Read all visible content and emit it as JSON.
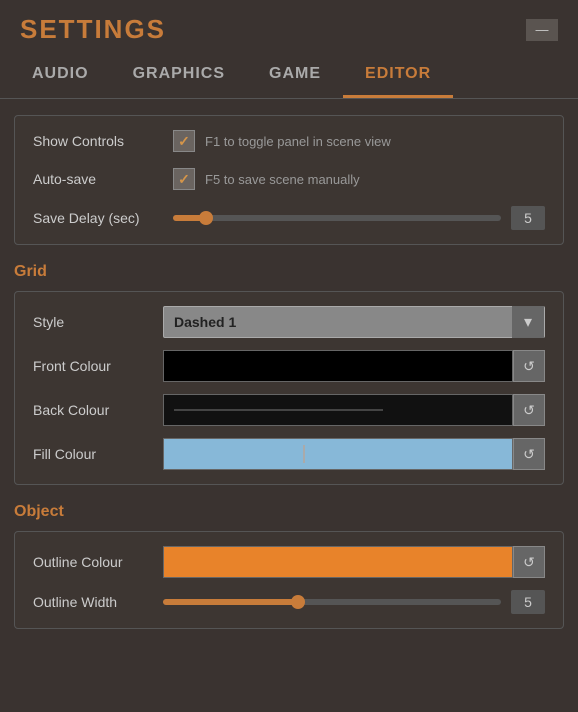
{
  "header": {
    "title": "SETTINGS",
    "close_label": "—"
  },
  "nav": {
    "tabs": [
      {
        "id": "audio",
        "label": "AUDIO",
        "active": false
      },
      {
        "id": "graphics",
        "label": "GRAPHICS",
        "active": false
      },
      {
        "id": "game",
        "label": "GAME",
        "active": false
      },
      {
        "id": "editor",
        "label": "EDITOR",
        "active": true
      }
    ]
  },
  "editor": {
    "show_controls": {
      "label": "Show Controls",
      "checked": true,
      "hint": "F1 to toggle panel in scene view"
    },
    "auto_save": {
      "label": "Auto-save",
      "checked": true,
      "hint": "F5 to save scene manually"
    },
    "save_delay": {
      "label": "Save Delay (sec)",
      "value": 5,
      "percent": 10
    }
  },
  "grid": {
    "heading": "Grid",
    "style": {
      "label": "Style",
      "value": "Dashed 1"
    },
    "front_colour": {
      "label": "Front Colour",
      "reset_label": "↺"
    },
    "back_colour": {
      "label": "Back Colour",
      "reset_label": "↺"
    },
    "fill_colour": {
      "label": "Fill Colour",
      "reset_label": "↺"
    }
  },
  "object": {
    "heading": "Object",
    "outline_colour": {
      "label": "Outline Colour",
      "reset_label": "↺"
    },
    "outline_width": {
      "label": "Outline Width",
      "value": 5
    }
  }
}
